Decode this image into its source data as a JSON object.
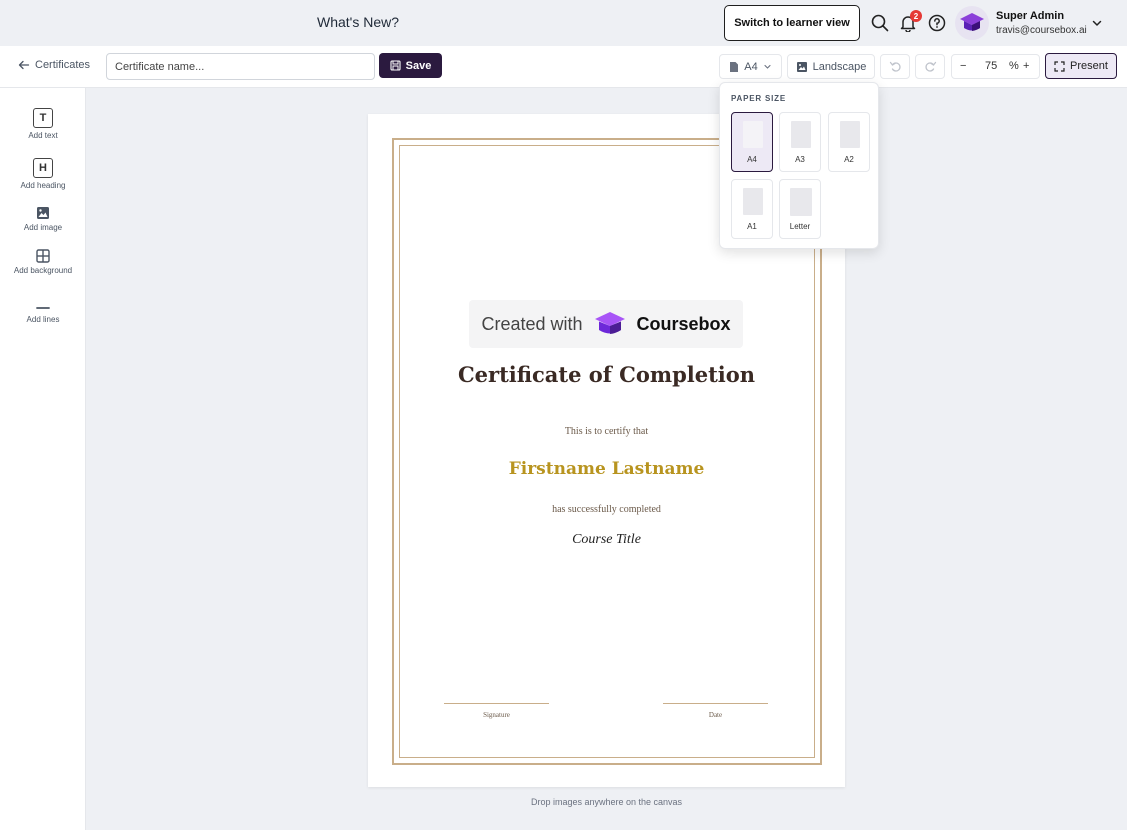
{
  "header": {
    "whats_new": "What's New?",
    "learner_view_button": "Switch to learner view",
    "notification_count": "2",
    "user_name": "Super Admin",
    "user_email": "travis@coursebox.ai"
  },
  "toolbar": {
    "back_label": "Certificates",
    "name_placeholder": "Certificate name...",
    "save_label": "Save",
    "paper_size": "A4",
    "orientation": "Landscape",
    "zoom_value": "75",
    "zoom_unit": "%",
    "zoom_minus": "−",
    "zoom_plus": "+",
    "present_label": "Present"
  },
  "tools": {
    "text_label": "Add text",
    "text_glyph": "T",
    "heading_label": "Add heading",
    "heading_glyph": "H",
    "image_label": "Add image",
    "background_label": "Add background",
    "lines_label": "Add lines"
  },
  "paper_popover": {
    "title": "PAPER SIZE",
    "options": [
      "A4",
      "A3",
      "A2",
      "A1",
      "Letter"
    ],
    "selected": "A4"
  },
  "certificate": {
    "brand_created": "Created with",
    "brand_name": "Coursebox",
    "title": "Certificate of Completion",
    "certify_text": "This is to certify that",
    "recipient": "Firstname Lastname",
    "completed_text": "has successfully completed",
    "course_title": "Course Title",
    "signature_label": "Signature",
    "date_label": "Date"
  },
  "canvas_hint": "Drop images anywhere on the canvas",
  "colors": {
    "brand_dark": "#2b1a3f",
    "brand_purple": "#7c3aed",
    "gold_border": "#c9ae8a",
    "recipient_gold": "#b8941f",
    "badge_red": "#e53935"
  }
}
